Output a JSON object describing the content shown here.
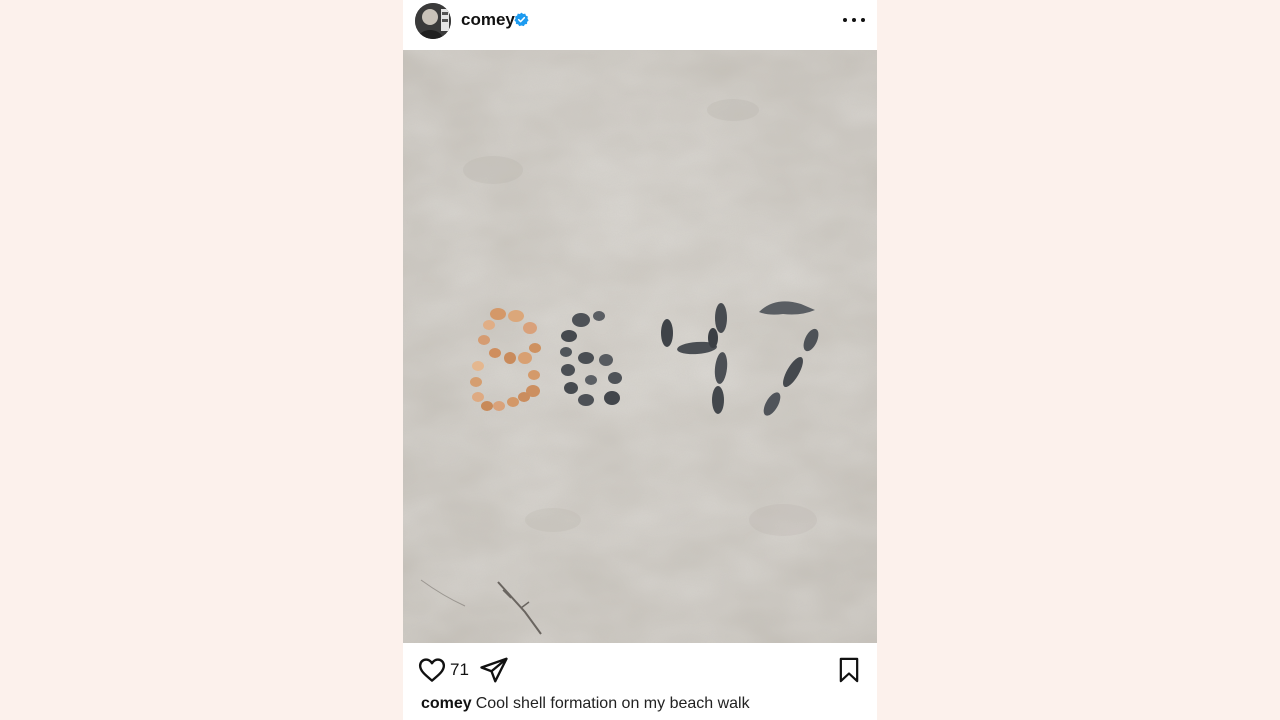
{
  "post": {
    "username": "comey",
    "verified": true,
    "likes": "71",
    "caption": "Cool shell formation on my beach walk",
    "photo_text": "8647"
  },
  "colors": {
    "background": "#fcf1ec",
    "card": "#ffffff",
    "verified_badge": "#1d9bf0",
    "sand": "#c8c4bd",
    "orange_shells": "#d49a6a",
    "dark_shells": "#4f5358"
  },
  "icons": {
    "like": "heart-icon",
    "share": "paper-plane-icon",
    "save": "bookmark-icon",
    "more": "more-dots-icon",
    "verified": "verified-badge-icon"
  }
}
